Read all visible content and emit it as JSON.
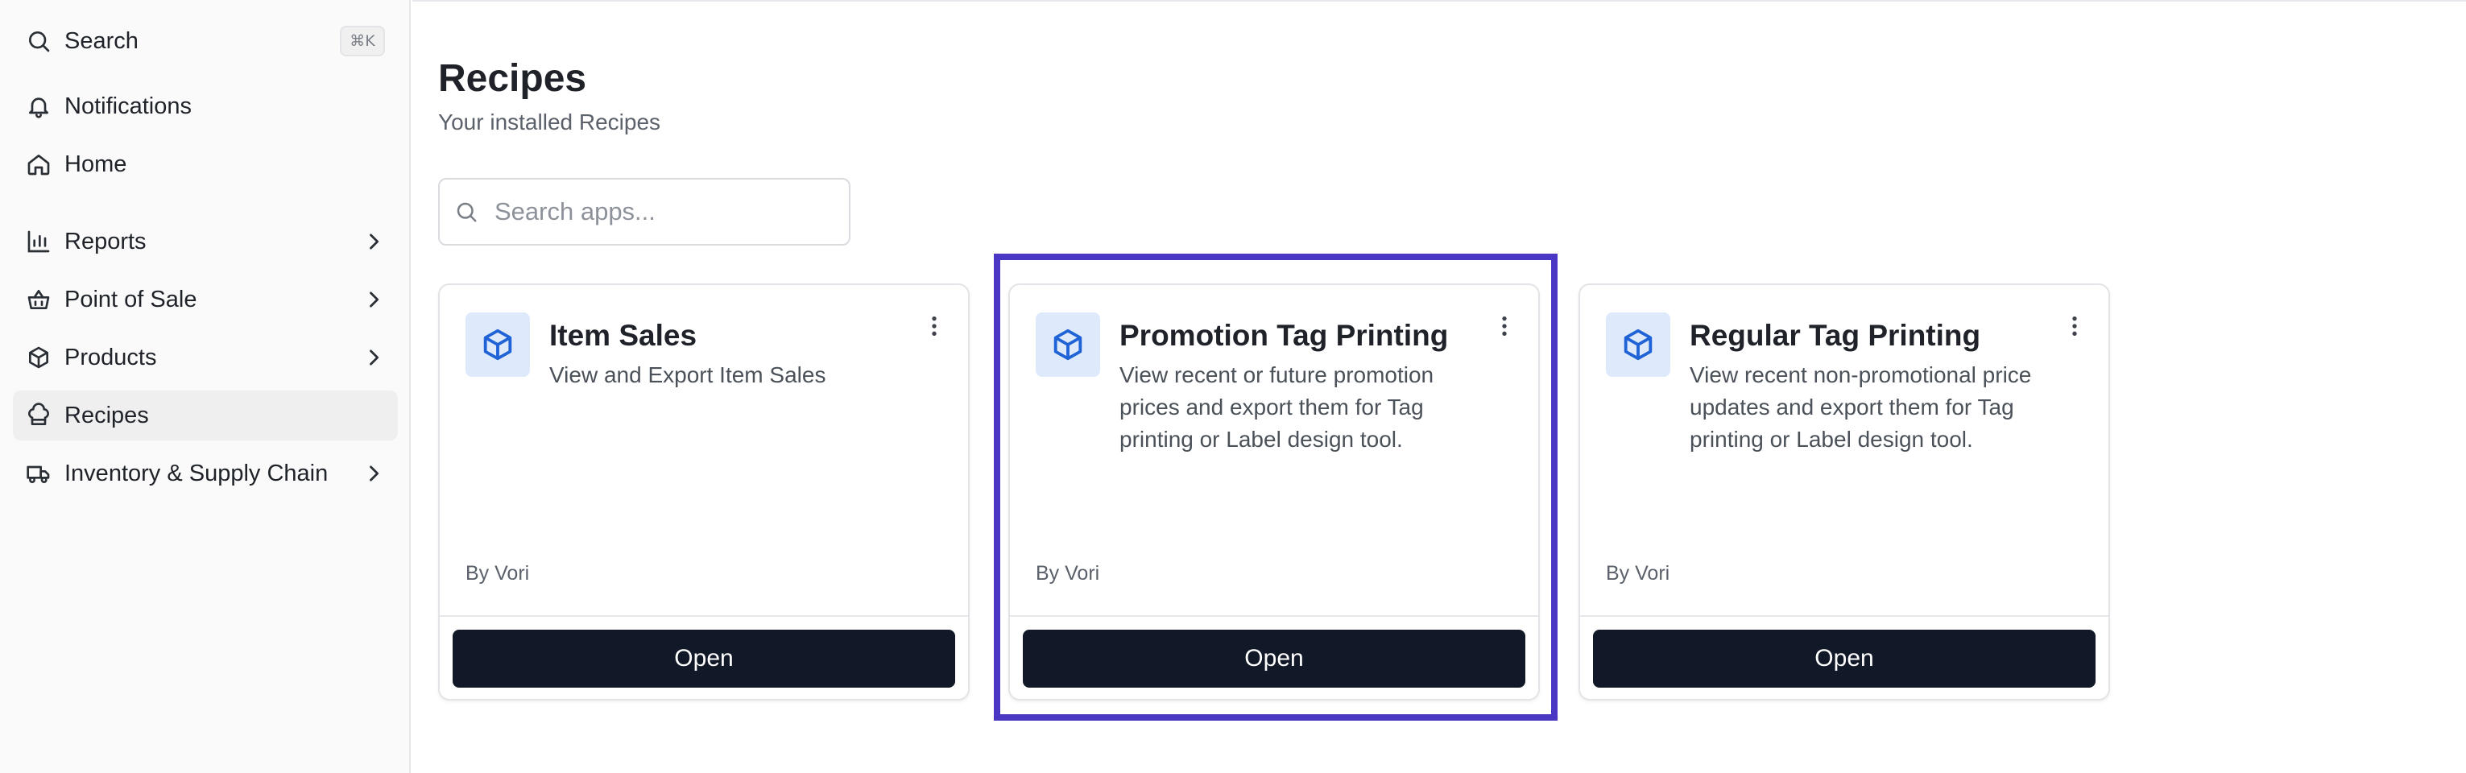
{
  "sidebar": {
    "search": {
      "label": "Search",
      "shortcut": "⌘K",
      "icon": "search-icon"
    },
    "items": [
      {
        "label": "Notifications",
        "icon": "bell-icon",
        "has_chevron": false
      },
      {
        "label": "Home",
        "icon": "home-icon",
        "has_chevron": false
      },
      {
        "label": "Reports",
        "icon": "bar-chart-icon",
        "has_chevron": true
      },
      {
        "label": "Point of Sale",
        "icon": "basket-icon",
        "has_chevron": true
      },
      {
        "label": "Products",
        "icon": "box-icon",
        "has_chevron": true
      },
      {
        "label": "Recipes",
        "icon": "recipe-icon",
        "has_chevron": false,
        "active": true
      },
      {
        "label": "Inventory & Supply Chain",
        "icon": "truck-icon",
        "has_chevron": true
      }
    ]
  },
  "main": {
    "title": "Recipes",
    "subtitle": "Your installed Recipes",
    "search": {
      "placeholder": "Search apps...",
      "value": ""
    }
  },
  "cards": [
    {
      "title": "Item Sales",
      "description": "View and Export Item Sales",
      "author": "By Vori",
      "button": "Open",
      "icon": "cube-icon"
    },
    {
      "title": "Promotion Tag Printing",
      "description": "View recent or future promotion prices and export them for Tag printing or Label design tool.",
      "author": "By Vori",
      "button": "Open",
      "icon": "cube-icon",
      "highlighted": true
    },
    {
      "title": "Regular Tag Printing",
      "description": "View recent non-promotional price updates and export them for Tag printing or Label design tool.",
      "author": "By Vori",
      "button": "Open",
      "icon": "cube-icon"
    }
  ],
  "colors": {
    "accent_highlight": "#4a38c4",
    "button_bg": "#111827",
    "icon_tile_bg": "#deeafb",
    "icon_color": "#1f63d6"
  }
}
